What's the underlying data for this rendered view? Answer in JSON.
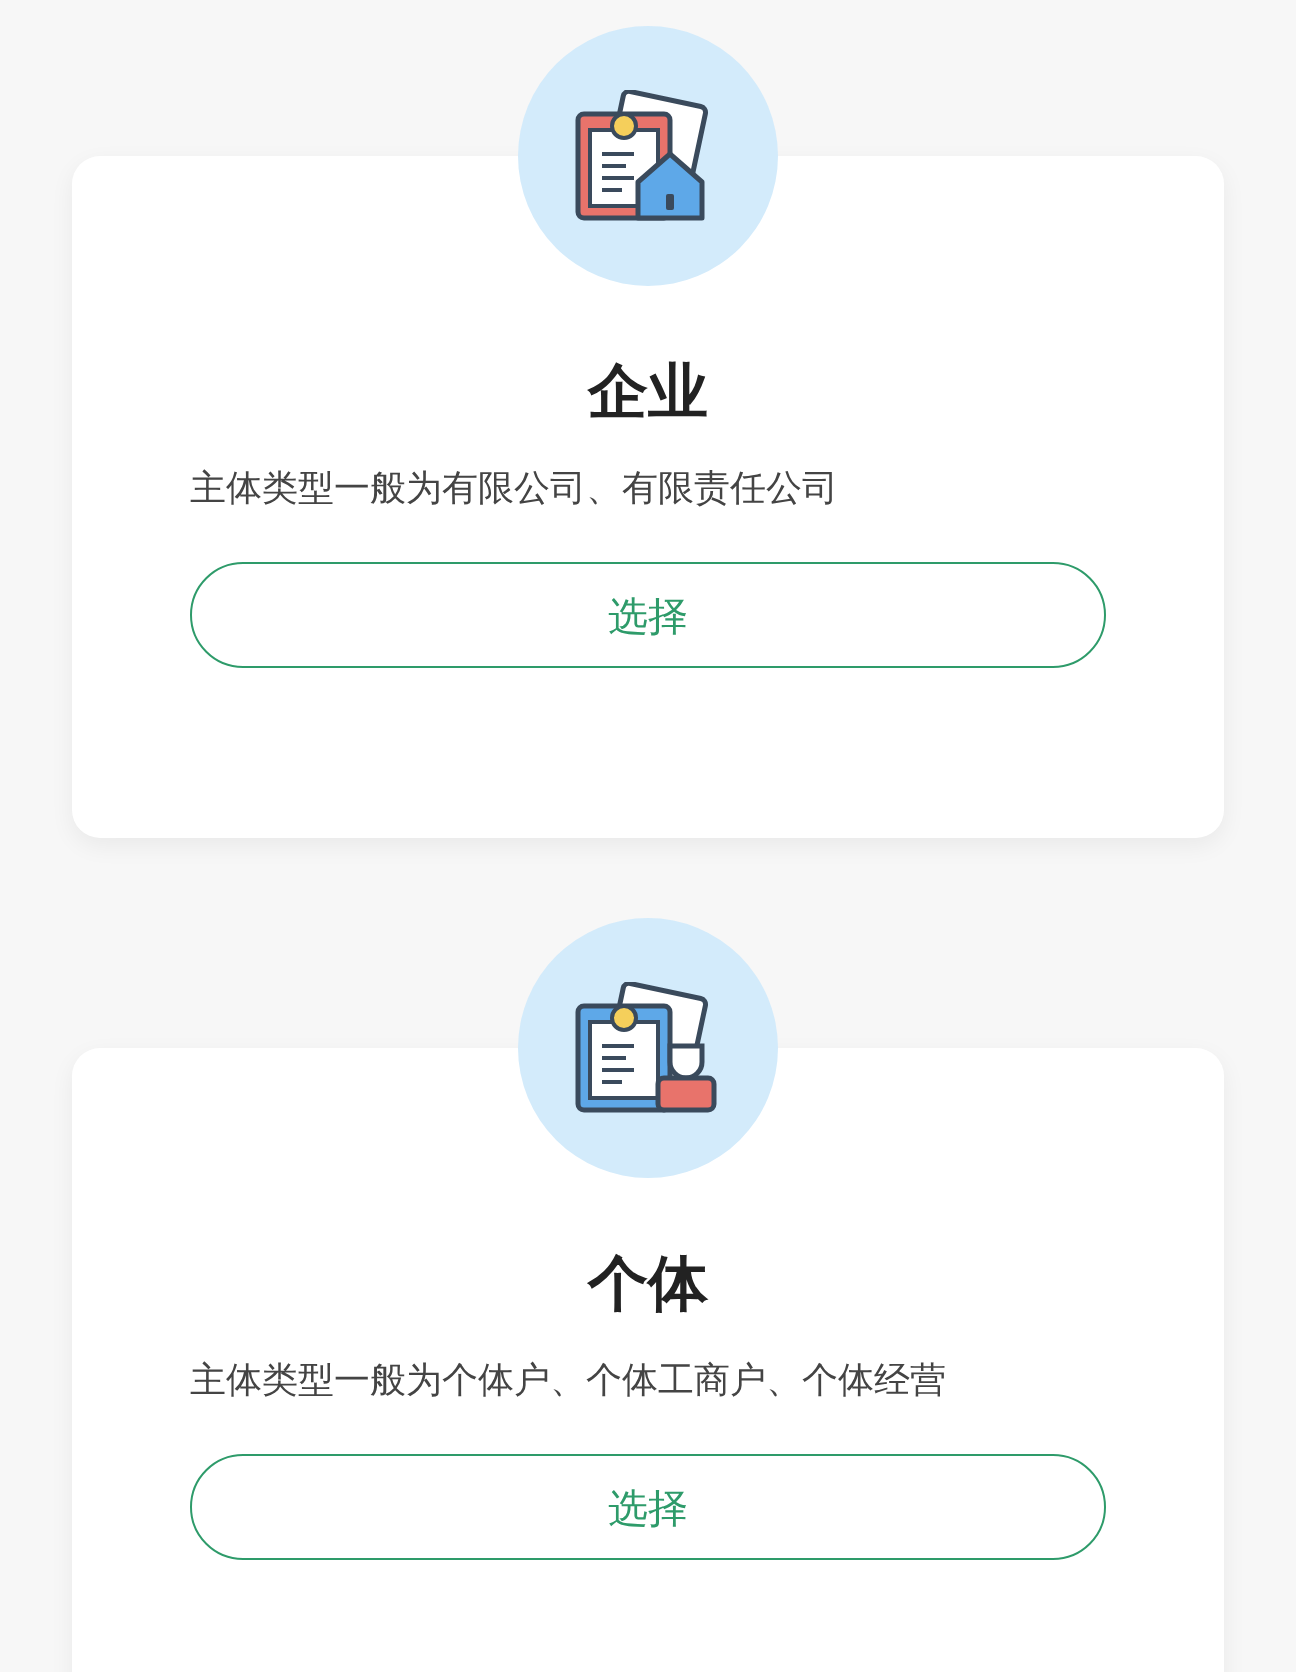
{
  "cards": [
    {
      "kind": "enterprise",
      "title": "企业",
      "description": "主体类型一般为有限公司、有限责任公司",
      "button": "选择"
    },
    {
      "kind": "individual",
      "title": "个体",
      "description": "主体类型一般为个体户、个体工商户、个体经营",
      "button": "选择"
    }
  ]
}
